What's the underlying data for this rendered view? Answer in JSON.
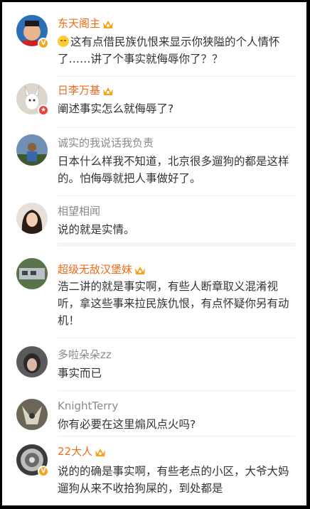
{
  "comments": [
    {
      "username": "东天阁主",
      "text": "这有点借民族仇恨来显示你狭隘的个人情怀了……讲了个事实就侮辱你了？？",
      "has_emoji": true
    },
    {
      "username": "日李万基",
      "text": "阐述事实怎么就侮辱了?"
    },
    {
      "username": "诚实的我说话我负责",
      "text": "日本什么样我不知道，北京很多遛狗的都是这样的。怕侮辱就把人事做好了。"
    },
    {
      "username": "相望相闻",
      "text": "说的就是实情。"
    },
    {
      "username": "超级无敌汉堡妹",
      "text": "浩二讲的就是事实啊，有些人断章取义混淆视听，拿这些事来拉民族仇恨，有点怀疑你另有动机！"
    },
    {
      "username": "多啦朵朵zz",
      "text": "事实而已"
    },
    {
      "username": "KnightTerry",
      "text": "你有必要在这里煽风点火吗?"
    },
    {
      "username": "22大人",
      "text": "说的的确是事实啊，有些老点的小区，大爷大妈遛狗从来不收拾狗屎的，到处都是"
    }
  ],
  "colors": {
    "vip_name": "#f06b17",
    "normal_name": "#8a8a8a",
    "body_text": "#333333",
    "verified_badge": "#f5a623"
  },
  "icons": {
    "crown": "vip-crown-icon",
    "verified": "verified-badge-icon",
    "emoji": "smirk-emoji-icon"
  }
}
